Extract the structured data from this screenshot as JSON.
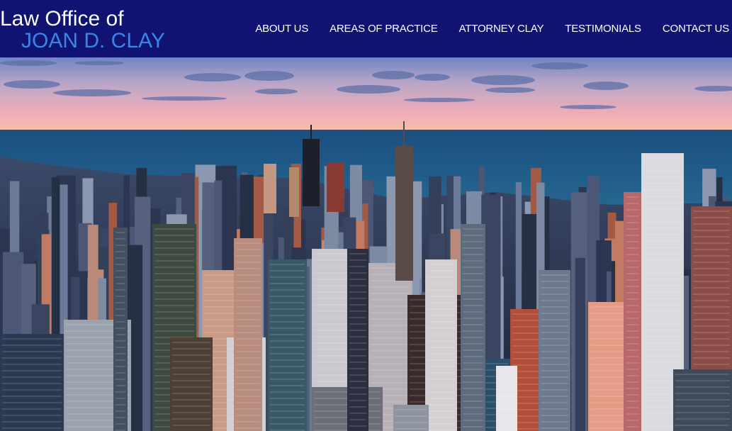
{
  "header": {
    "logo_line1": "Law Office of",
    "logo_line2": "JOAN D. CLAY",
    "background": "#101371",
    "accent": "#3a86e6"
  },
  "nav": {
    "items": [
      {
        "label": "ABOUT US"
      },
      {
        "label": "AREAS OF PRACTICE"
      },
      {
        "label": "ATTORNEY CLAY"
      },
      {
        "label": "TESTIMONIALS"
      },
      {
        "label": "CONTACT US"
      }
    ]
  },
  "hero": {
    "image": "aerial-city-skyline-at-dusk",
    "sky_colors": [
      "#7f93c8",
      "#e9a9b6",
      "#f3b9a7"
    ],
    "water_color": "#1f5a86"
  }
}
